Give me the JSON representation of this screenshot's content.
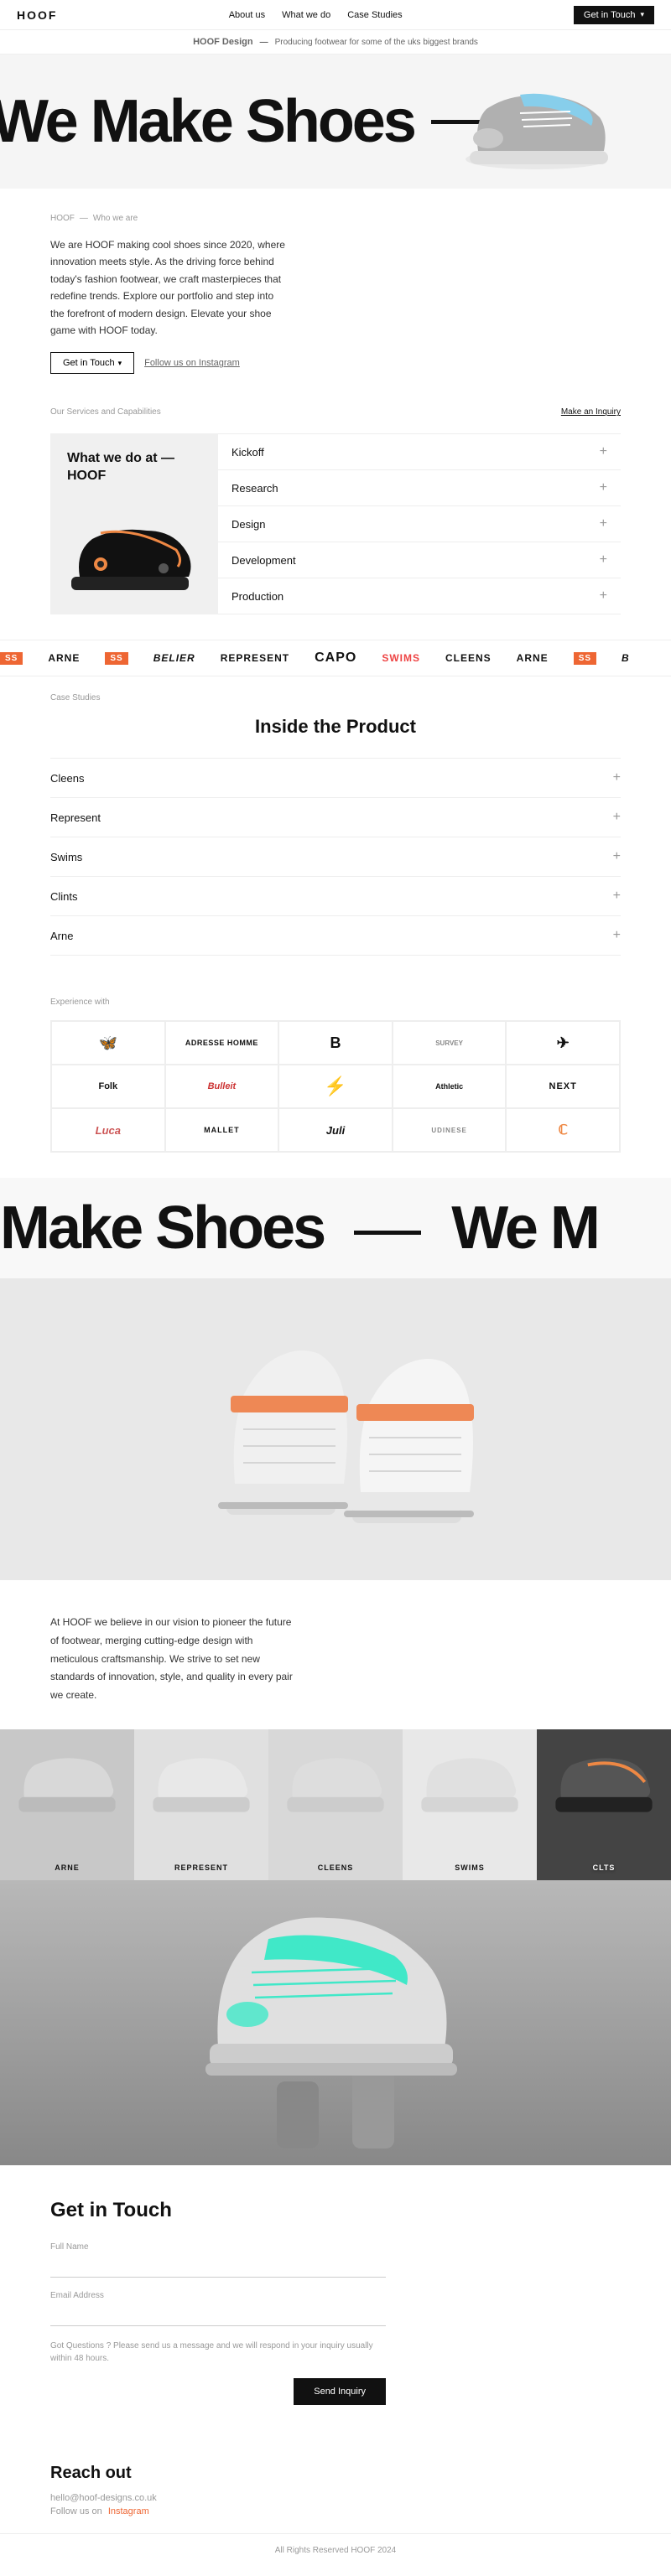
{
  "nav": {
    "logo": "HOOF",
    "links": [
      {
        "label": "About us",
        "href": "#"
      },
      {
        "label": "What we do",
        "href": "#"
      },
      {
        "label": "Case Studies",
        "href": "#"
      }
    ],
    "cta": "Get in Touch"
  },
  "tagline": {
    "brand": "HOOF Design",
    "separator": "—",
    "text": "Producing footwear for some of the uks biggest brands"
  },
  "hero": {
    "headline": "We Make Shoes"
  },
  "breadcrumb": {
    "home": "HOOF",
    "separator": "—",
    "page": "Who we are"
  },
  "about": {
    "text": "We are HOOF making cool shoes since 2020, where innovation meets style. As the driving force behind today's fashion footwear, we craft masterpieces that redefine trends. Explore our portfolio and step into the forefront of modern design. Elevate your shoe game with HOOF today.",
    "cta_label": "Get in Touch",
    "instagram_label": "Follow us on Instagram"
  },
  "services": {
    "header_label": "Our Services and Capabilities",
    "inquiry_label": "Make an Inquiry",
    "card_title": "What we do at — HOOF",
    "items": [
      {
        "label": "Kickoff"
      },
      {
        "label": "Research"
      },
      {
        "label": "Design"
      },
      {
        "label": "Development"
      },
      {
        "label": "Production"
      }
    ]
  },
  "brands_ticker": {
    "items": [
      {
        "label": "SS",
        "type": "red-box"
      },
      {
        "label": "ARNE",
        "type": "normal"
      },
      {
        "label": "SS",
        "type": "red-box"
      },
      {
        "label": "BELIER",
        "type": "normal"
      },
      {
        "label": "REPRESENT",
        "type": "normal"
      },
      {
        "label": "CAPO",
        "type": "normal"
      },
      {
        "label": "SWIMS",
        "type": "swims"
      },
      {
        "label": "CLEENS",
        "type": "normal"
      },
      {
        "label": "ARNE",
        "type": "normal"
      },
      {
        "label": "SS",
        "type": "red-box"
      }
    ]
  },
  "case_studies": {
    "section_label": "Case Studies",
    "title": "Inside the Product",
    "items": [
      {
        "label": "Cleens"
      },
      {
        "label": "Represent"
      },
      {
        "label": "Swims"
      },
      {
        "label": "Clints"
      },
      {
        "label": "Arne"
      }
    ]
  },
  "experience": {
    "section_label": "Experience with",
    "grid": [
      [
        {
          "label": "🦋",
          "type": "icon"
        },
        {
          "label": "ADRESSE HOMME",
          "type": "normal"
        },
        {
          "label": "B",
          "type": "bold"
        },
        {
          "label": "SURVEY",
          "type": "small"
        },
        {
          "label": "✈",
          "type": "icon"
        }
      ],
      [
        {
          "label": "Folk",
          "type": "normal"
        },
        {
          "label": "Bulleit",
          "type": "red"
        },
        {
          "label": "⚡",
          "type": "icon"
        },
        {
          "label": "Athletic",
          "type": "normal"
        },
        {
          "label": "NEXT",
          "type": "bold"
        }
      ],
      [
        {
          "label": "Luca",
          "type": "red"
        },
        {
          "label": "MALLET",
          "type": "normal"
        },
        {
          "label": "Juli",
          "type": "script"
        },
        {
          "label": "UDINESE",
          "type": "normal"
        },
        {
          "label": "C",
          "type": "orange"
        }
      ]
    ]
  },
  "hero2": {
    "headline": "Make Shoes — We M"
  },
  "vision": {
    "text": "At HOOF we believe in our vision to pioneer the future of footwear, merging cutting-edge design with meticulous craftsmanship. We strive to set new standards of innovation, style, and quality in every pair we create."
  },
  "product_cards": [
    {
      "label": "ARNE"
    },
    {
      "label": "REPRESENT"
    },
    {
      "label": "CLEENS"
    },
    {
      "label": "SWIMS"
    },
    {
      "label": "CLTS"
    }
  ],
  "contact": {
    "title": "Get in Touch",
    "full_name_label": "Full Name",
    "full_name_placeholder": "",
    "email_label": "Email Address",
    "email_placeholder": "",
    "note": "Got Questions ? Please send us a message and we will respond in your inquiry usually within 48 hours.",
    "submit_label": "Send Inquiry"
  },
  "reach_out": {
    "title": "Reach out",
    "email": "hello@hoof-designs.co.uk",
    "social_prefix": "Follow us on",
    "social_label": "Instagram"
  },
  "footer": {
    "text": "All Rights Reserved HOOF 2024"
  }
}
